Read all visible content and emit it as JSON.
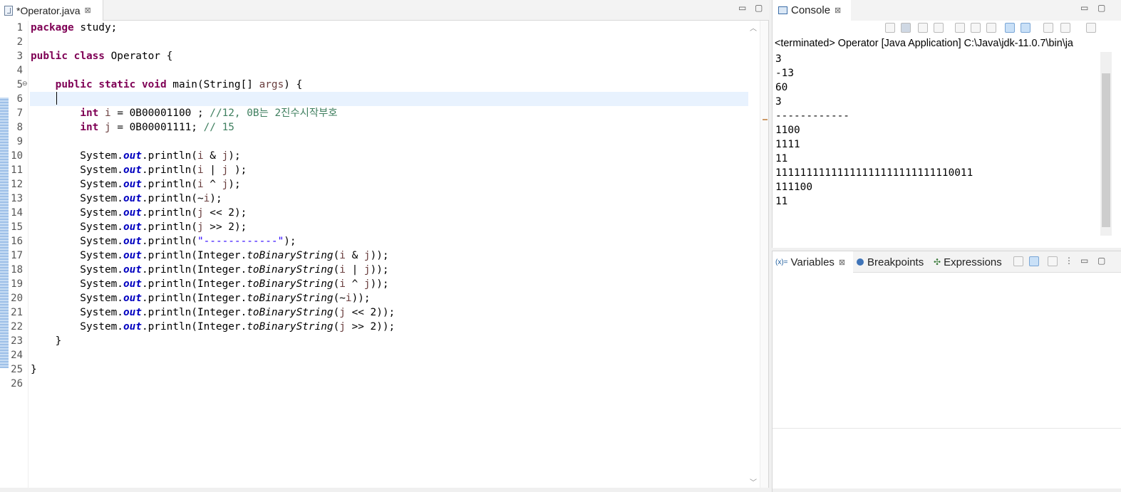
{
  "editor": {
    "tab_title": "*Operator.java",
    "close_glyph": "⊠",
    "line_numbers": [
      "1",
      "2",
      "3",
      "4",
      "5",
      "6",
      "7",
      "8",
      "9",
      "10",
      "11",
      "12",
      "13",
      "14",
      "15",
      "16",
      "17",
      "18",
      "19",
      "20",
      "21",
      "22",
      "23",
      "24",
      "25",
      "26"
    ],
    "fold_glyph": "⊖",
    "minimize_glyph": "▭",
    "maximize_glyph": "▢"
  },
  "console": {
    "tab_title": "Console",
    "close_glyph": "⊠",
    "status": "<terminated> Operator [Java Application] C:\\Java\\jdk-11.0.7\\bin\\ja",
    "output": [
      "3",
      "-13",
      "60",
      "3",
      "------------",
      "1100",
      "1111",
      "11",
      "11111111111111111111111111110011",
      "111100",
      "11"
    ]
  },
  "debug_views": {
    "variables_label": "Variables",
    "variables_icon": "(x)=",
    "breakpoints_label": "Breakpoints",
    "expressions_label": "Expressions",
    "close_glyph": "⊠"
  },
  "icons": {
    "file": "java-file-icon",
    "console": "console-monitor-icon",
    "breakpoint": "breakpoint-icon",
    "expressions": "expressions-icon"
  },
  "colors": {
    "keyword": "#7f0055",
    "comment": "#3f7f5f",
    "string": "#2a00ff",
    "static_field": "#0000c0",
    "current_line": "#e8f2fe"
  }
}
